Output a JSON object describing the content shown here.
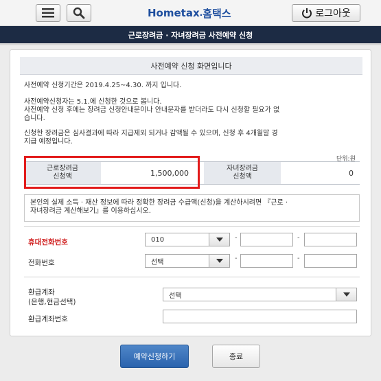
{
  "header": {
    "logo_en": "Hometax",
    "logo_ko": "홈택스",
    "logout_label": "로그아웃",
    "menu_icon": "menu-icon",
    "search_icon": "search-icon",
    "power_icon": "power-icon"
  },
  "page_title": "근로장려금 · 자녀장려금 사전예약 신청",
  "notice": {
    "heading": "사전예약 신청 화면입니다",
    "period": "사전예약 신청기간은 2019.4.25~4.30. 까지 입니다.",
    "para2_line1": "사전예약신청자는 5.1.에 신청한 것으로 봅니다.",
    "para2_line2": "사전예약 신청 후에는 장려금 신청안내문이나 안내문자를 받더라도 다시 신청할 필요가 없",
    "para2_line3": "습니다.",
    "para3_line1": "신청한 장려금은 심사결과에 따라 지급제외 되거나 감액될 수 있으며, 신청 후 4개월말 경",
    "para3_line2": "지급 예정입니다."
  },
  "amounts": {
    "unit": "단위:원",
    "earned": {
      "label_line1": "근로장려금",
      "label_line2": "신청액",
      "value": "1,500,000"
    },
    "child": {
      "label_line1": "자녀장려금",
      "label_line2": "신청액",
      "value": "0"
    }
  },
  "info": {
    "line1": "본인의 실제 소득 · 재산 정보에 따라 정확한 장려금 수급액(신청)을 계산하시려면 『근로 ·",
    "line2": "자녀장려금 계산해보기』를 이용하십시오."
  },
  "form": {
    "mobile": {
      "label": "휴대전화번호",
      "prefix": "010",
      "dash1": "-",
      "dash2": "-"
    },
    "phone": {
      "label": "전화번호",
      "prefix": "선택",
      "dash1": "-",
      "dash2": "-"
    },
    "refund_account": {
      "label_line1": "환급계좌",
      "label_line2": "(은행,현금선택)",
      "selected": "선택"
    },
    "account_number": {
      "label": "환급계좌번호"
    }
  },
  "actions": {
    "submit_label": "예약신청하기",
    "close_label": "종료"
  },
  "colors": {
    "title_bar": "#1c2b44",
    "required_label": "#d01f1f",
    "highlight_border": "#e21b1b",
    "primary_button": "#2a63ad"
  }
}
